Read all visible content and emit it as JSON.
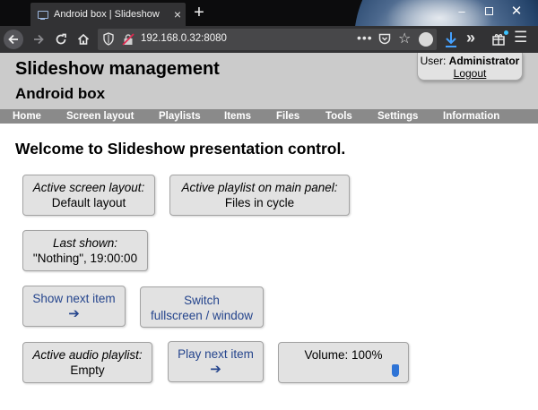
{
  "browser": {
    "tab_title": "Android box | Slideshow",
    "tab_close": "×",
    "new_tab": "+",
    "url": "192.168.0.32:8080",
    "window_min": "–",
    "window_close": "✕",
    "icons": [
      "back-icon",
      "forward-icon",
      "reload-icon",
      "home-icon",
      "shield-icon",
      "insecure-lock-icon",
      "more-icon",
      "pocket-icon",
      "star-icon",
      "account-icon",
      "download-icon",
      "overflow-icon",
      "extension-icon",
      "menu-icon"
    ]
  },
  "header": {
    "title": "Slideshow management",
    "subtitle": "Android box",
    "user_label": "User:",
    "user_name": "Administrator",
    "logout": "Logout"
  },
  "menu": {
    "items": [
      "Home",
      "Screen layout",
      "Playlists",
      "Items",
      "Files",
      "Tools",
      "Settings",
      "Information"
    ]
  },
  "main": {
    "welcome": "Welcome to Slideshow presentation control.",
    "active_layout": {
      "label": "Active screen layout:",
      "value": "Default layout"
    },
    "active_playlist": {
      "label": "Active playlist on main panel:",
      "value": "Files in cycle"
    },
    "last_shown": {
      "label": "Last shown:",
      "value": "\"Nothing\", 19:00:00"
    },
    "show_next": {
      "label": "Show next item",
      "arrow": "➔"
    },
    "switch_mode": {
      "line1": "Switch",
      "line2": "fullscreen / window"
    },
    "active_audio": {
      "label": "Active audio playlist:",
      "value": "Empty"
    },
    "play_next": {
      "label": "Play next item",
      "arrow": "➔"
    },
    "volume": {
      "label": "Volume: 100%",
      "level": 1.0
    }
  },
  "colors": {
    "header_bg": "#cbcbcb",
    "menubar_bg": "#8a8a8a",
    "panel_bg": "#e2e2e2",
    "link_blue": "#25458d",
    "slider_blue": "#2f74d6"
  }
}
